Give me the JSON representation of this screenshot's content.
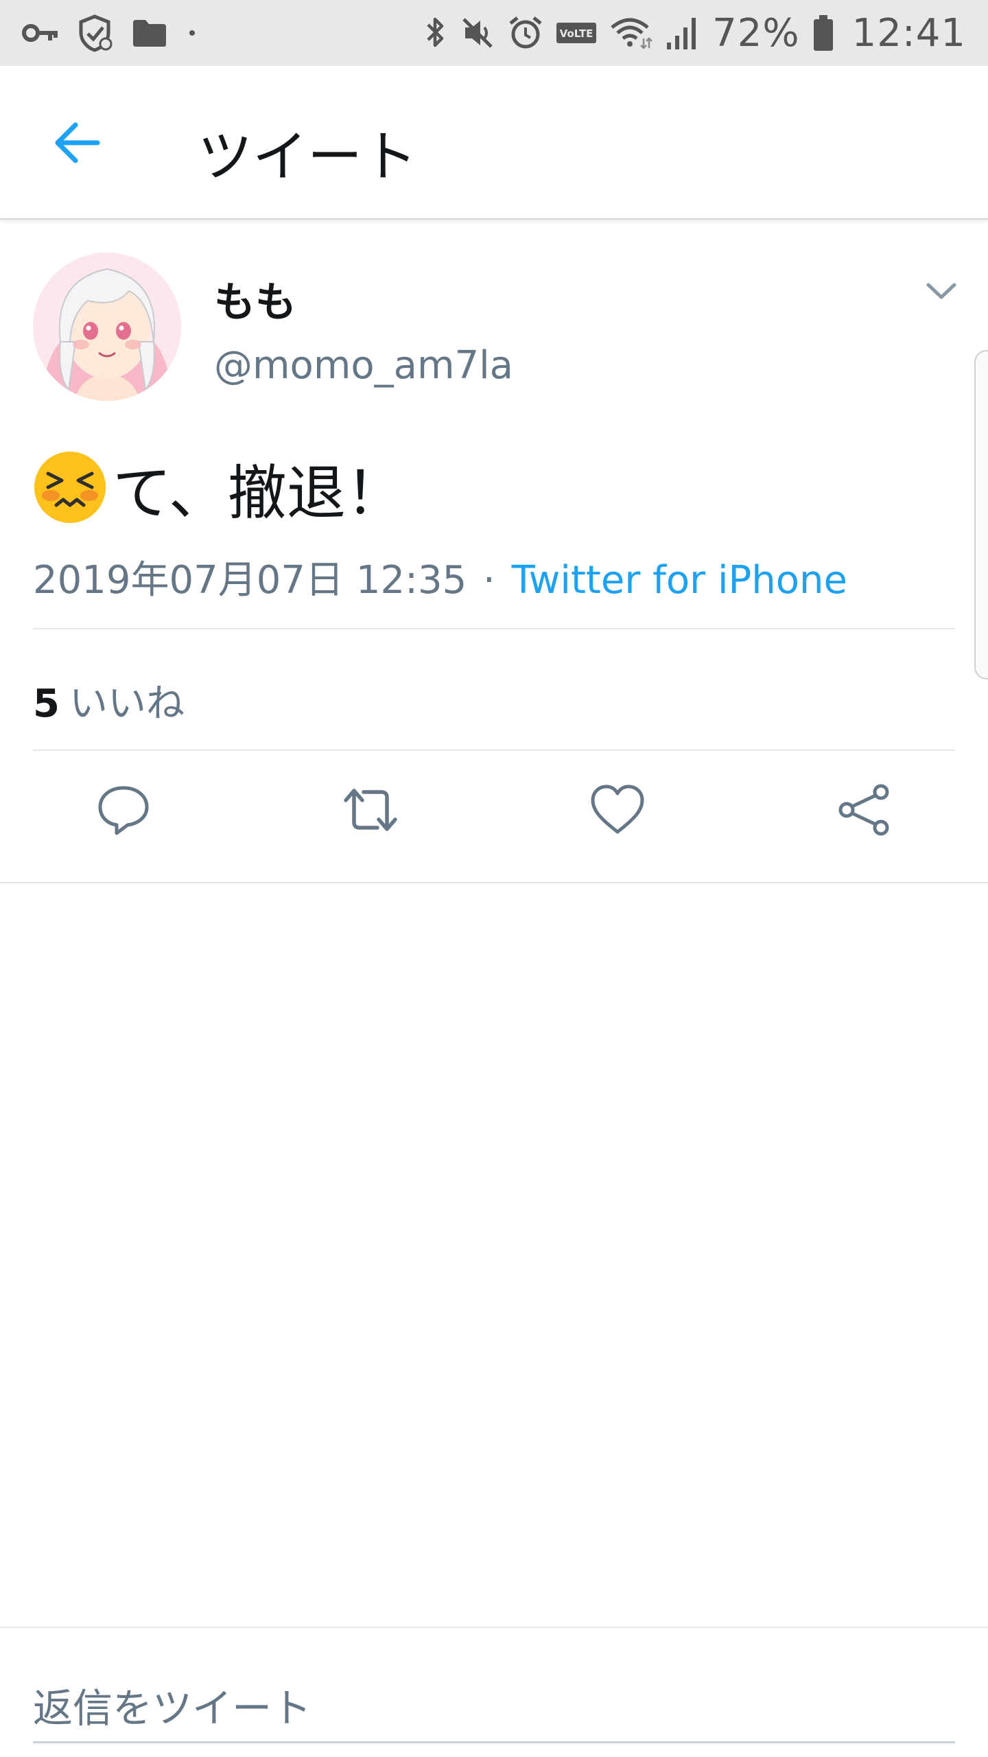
{
  "status_bar": {
    "battery_percent": "72%",
    "time": "12:41",
    "volte_label": "VoLTE"
  },
  "header": {
    "title": "ツイート"
  },
  "tweet": {
    "display_name": "もも",
    "handle": "@momo_am7la",
    "text": "て、撤退！",
    "timestamp": "2019年07月07日 12:35",
    "separator": "·",
    "source": "Twitter for iPhone",
    "likes_count": "5",
    "likes_label": "いいね"
  },
  "reply": {
    "placeholder": "返信をツイート"
  },
  "colors": {
    "accent": "#1da1f2",
    "secondary_text": "#657786",
    "primary_text": "#14171a",
    "icon": "#657786",
    "status_bar_bg": "#e8e8e8"
  }
}
